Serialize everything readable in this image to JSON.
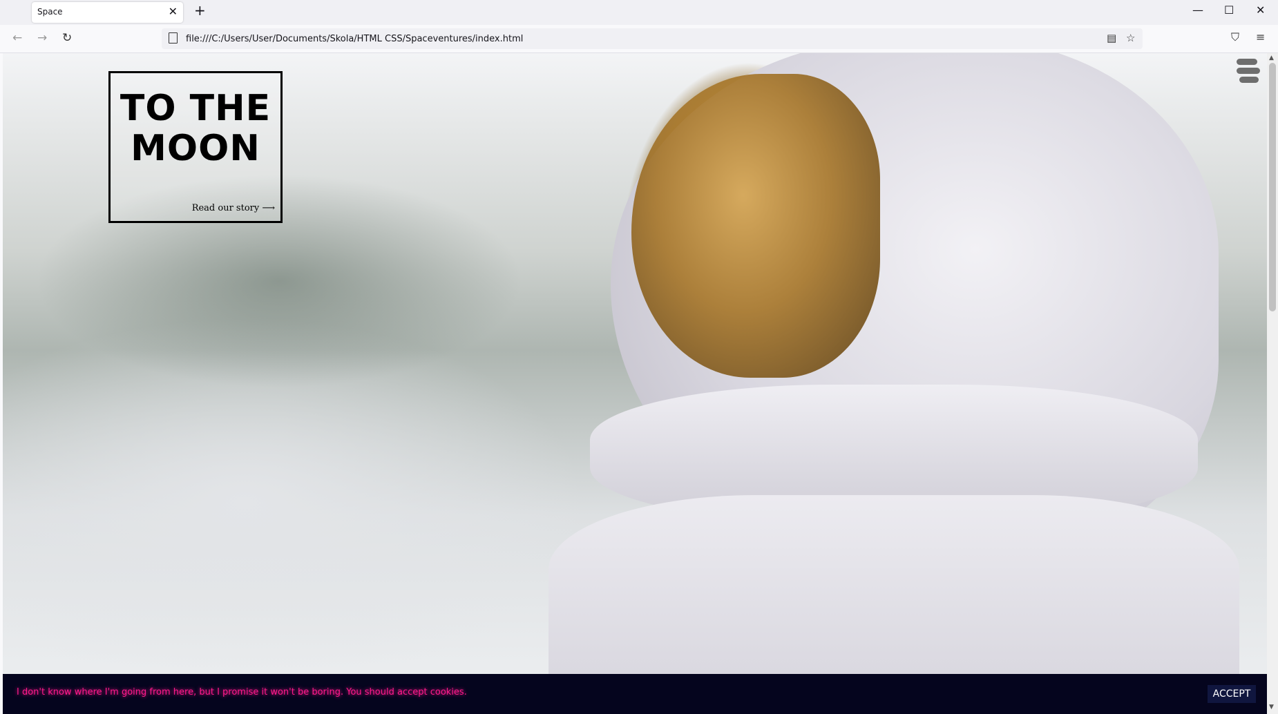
{
  "browser": {
    "tab_title": "Space",
    "tab_close": "✕",
    "new_tab": "+",
    "url": "file:///C:/Users/User/Documents/Skola/HTML CSS/Spaceventures/index.html",
    "back": "←",
    "forward": "→",
    "reload": "↻",
    "reader": "▤",
    "bookmark": "☆",
    "pocket": "⛉",
    "menu": "≡",
    "minimize": "—",
    "maximize": "☐",
    "close": "✕"
  },
  "hero": {
    "title": "TO THE MOON",
    "link": "Read our story ⟶"
  },
  "cookie": {
    "message": "I don't know where I'm going from here, but I promise it won't be boring. You should accept cookies.",
    "accept": "ACCEPT"
  },
  "icons": [
    "hamburger-menu-icon",
    "back-arrow-icon",
    "forward-arrow-icon",
    "reload-icon",
    "page-icon",
    "reader-mode-icon",
    "bookmark-star-icon",
    "pocket-icon",
    "app-menu-icon"
  ]
}
